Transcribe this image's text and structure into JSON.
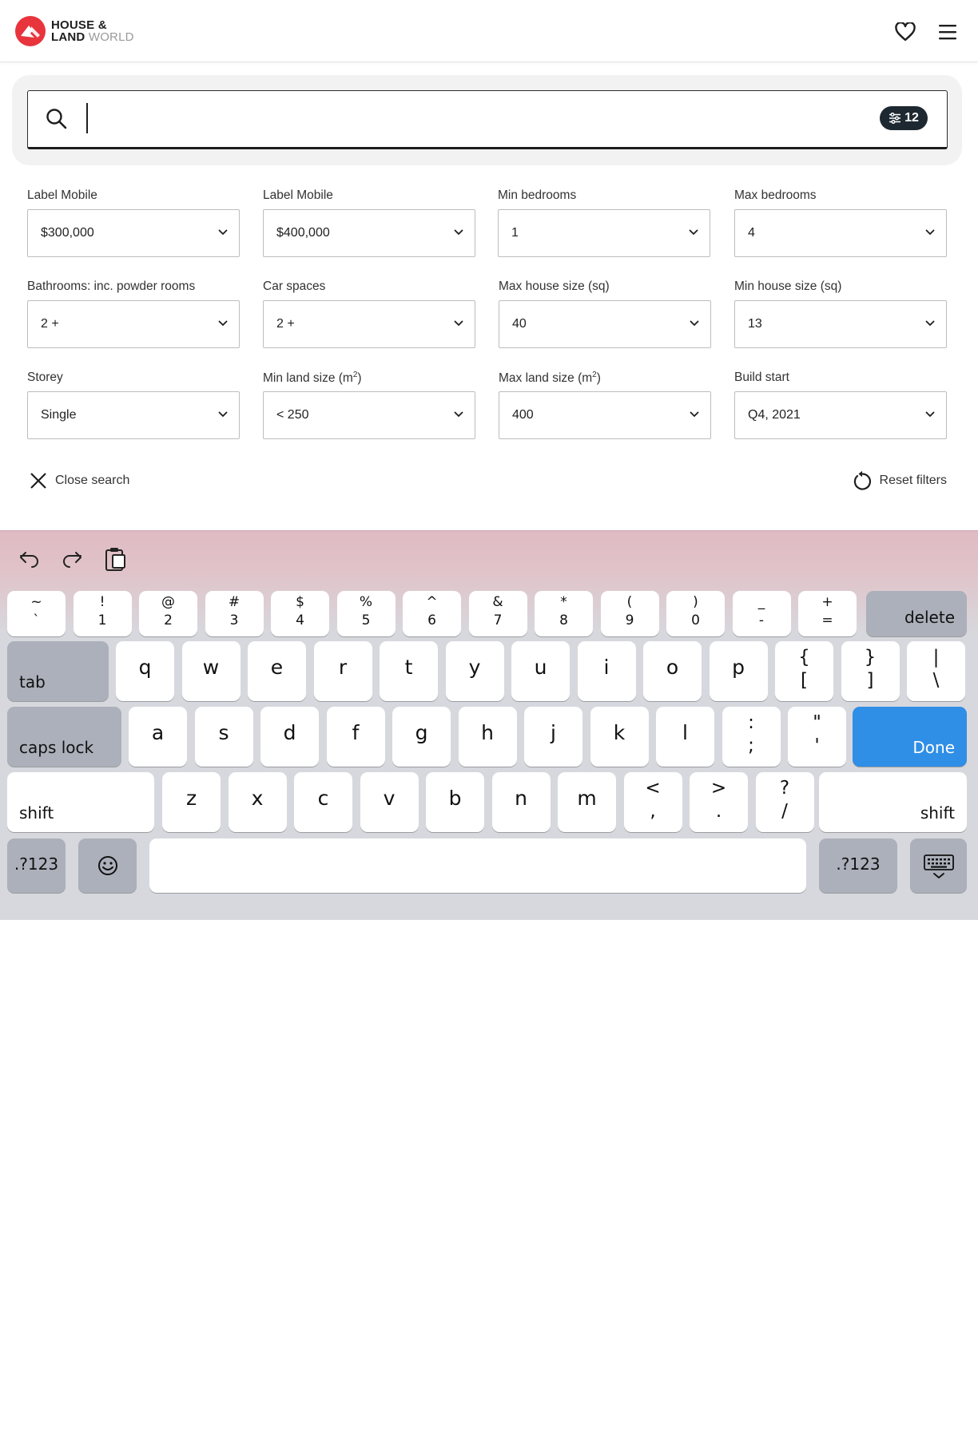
{
  "header": {
    "logo": {
      "line1": "HOUSE &",
      "line2_bold": "LAND",
      "line2_light": " WORLD"
    },
    "icons": [
      "heart-icon",
      "menu-icon"
    ]
  },
  "search": {
    "value": "",
    "placeholder": "",
    "filter_count": "12",
    "icon": "search-icon"
  },
  "filters": [
    {
      "label": "Label Mobile",
      "value": "$300,000"
    },
    {
      "label": "Label Mobile",
      "value": "$400,000"
    },
    {
      "label": "Min bedrooms",
      "value": "1"
    },
    {
      "label": "Max bedrooms",
      "value": "4"
    },
    {
      "label": "Bathrooms: inc. powder rooms",
      "value": "2 +"
    },
    {
      "label": "Car spaces",
      "value": "2 +"
    },
    {
      "label": "Max house size (sq)",
      "value": "40"
    },
    {
      "label": "Min house size (sq)",
      "value": "13"
    },
    {
      "label": "Storey",
      "value": "Single"
    },
    {
      "label": "Min land size (m",
      "label_sup": "2",
      "label_end": ")",
      "value": "< 250"
    },
    {
      "label": "Max land size (m",
      "label_sup": "2",
      "label_end": ")",
      "value": "400"
    },
    {
      "label": "Build start",
      "value": "Q4, 2021"
    }
  ],
  "actions": {
    "close_search": "Close search",
    "reset_filters": "Reset filters"
  },
  "keyboard": {
    "toolbar": [
      "undo-icon",
      "redo-icon",
      "paste-icon"
    ],
    "number_row": [
      {
        "top": "~",
        "bot": "`"
      },
      {
        "top": "!",
        "bot": "1"
      },
      {
        "top": "@",
        "bot": "2"
      },
      {
        "top": "#",
        "bot": "3"
      },
      {
        "top": "$",
        "bot": "4"
      },
      {
        "top": "%",
        "bot": "5"
      },
      {
        "top": "^",
        "bot": "6"
      },
      {
        "top": "&",
        "bot": "7"
      },
      {
        "top": "*",
        "bot": "8"
      },
      {
        "top": "(",
        "bot": "9"
      },
      {
        "top": ")",
        "bot": "0"
      },
      {
        "top": "_",
        "bot": "-"
      },
      {
        "top": "+",
        "bot": "="
      }
    ],
    "delete": "delete",
    "tab": "tab",
    "row_q": [
      "q",
      "w",
      "e",
      "r",
      "t",
      "y",
      "u",
      "i",
      "o",
      "p"
    ],
    "row_q_pairs": [
      {
        "top": "{",
        "bot": "["
      },
      {
        "top": "}",
        "bot": "]"
      },
      {
        "top": "|",
        "bot": "\\"
      }
    ],
    "caps_lock": "caps lock",
    "row_a": [
      "a",
      "s",
      "d",
      "f",
      "g",
      "h",
      "j",
      "k",
      "l"
    ],
    "row_a_pairs": [
      {
        "top": ":",
        "bot": ";"
      },
      {
        "top": "\"",
        "bot": "'"
      }
    ],
    "done": "Done",
    "shift": "shift",
    "row_z": [
      "z",
      "x",
      "c",
      "v",
      "b",
      "n",
      "m"
    ],
    "row_z_pairs": [
      {
        "top": "<",
        "bot": ","
      },
      {
        "top": ">",
        "bot": "."
      },
      {
        "top": "?",
        "bot": "/"
      }
    ],
    "numbers_key": ".?123",
    "emoji": "emoji-icon",
    "hide_keyboard": "keyboard-hide-icon"
  },
  "colors": {
    "brand_red": "#e8343c",
    "badge_bg": "#1e2830",
    "done_blue": "#2f8ee6"
  }
}
